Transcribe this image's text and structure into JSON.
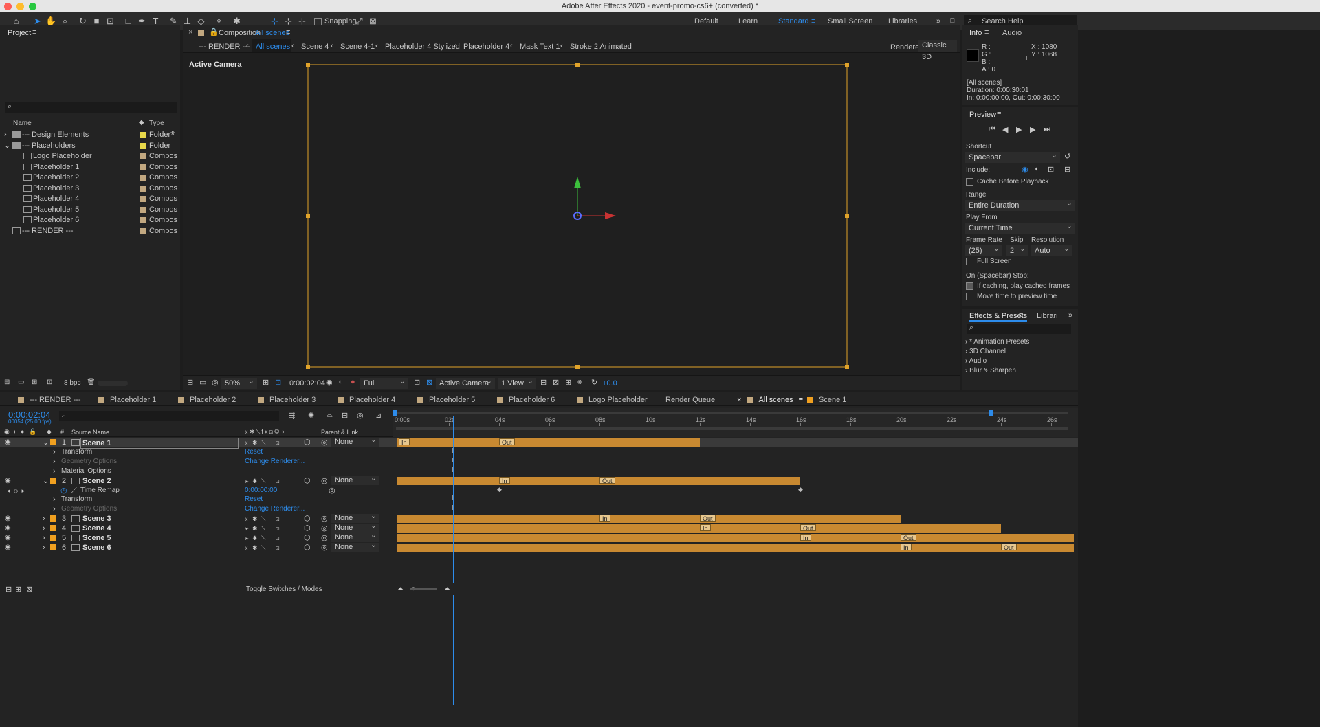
{
  "window": {
    "title": "Adobe After Effects 2020 - event-promo-cs6+ (converted) *"
  },
  "toolbar": {
    "snapping_label": "Snapping",
    "workspaces": [
      "Default",
      "Learn",
      "Standard",
      "Small Screen",
      "Libraries"
    ],
    "search_placeholder": "Search Help"
  },
  "project": {
    "title": "Project",
    "col_name": "Name",
    "col_type": "Type",
    "items": [
      {
        "name": "--- Design Elements",
        "type": "Folder",
        "kind": "folder",
        "color": "#e8d84a"
      },
      {
        "name": "--- Placeholders",
        "type": "Folder",
        "kind": "folder",
        "color": "#e8d84a"
      },
      {
        "name": "Logo Placeholder",
        "type": "Compos",
        "kind": "comp",
        "color": "#c2a880"
      },
      {
        "name": "Placeholder 1",
        "type": "Compos",
        "kind": "comp",
        "color": "#c2a880"
      },
      {
        "name": "Placeholder 2",
        "type": "Compos",
        "kind": "comp",
        "color": "#c2a880"
      },
      {
        "name": "Placeholder 3",
        "type": "Compos",
        "kind": "comp",
        "color": "#c2a880"
      },
      {
        "name": "Placeholder 4",
        "type": "Compos",
        "kind": "comp",
        "color": "#c2a880"
      },
      {
        "name": "Placeholder 5",
        "type": "Compos",
        "kind": "comp",
        "color": "#c2a880"
      },
      {
        "name": "Placeholder 6",
        "type": "Compos",
        "kind": "comp",
        "color": "#c2a880"
      },
      {
        "name": "--- RENDER ---",
        "type": "Compos",
        "kind": "comp",
        "color": "#c2a880"
      }
    ],
    "bpc": "8 bpc"
  },
  "composition": {
    "tab_prefix": "Composition",
    "tab_name": "All scenes",
    "breadcrumbs": [
      "--- RENDER ---",
      "All scenes",
      "Scene 4",
      "Scene 4-1",
      "Placeholder 4 Stylized",
      "Placeholder 4",
      "Mask Text 1",
      "Stroke 2 Animated"
    ],
    "renderer_label": "Renderer:",
    "renderer_value": "Classic 3D",
    "active_camera": "Active Camera",
    "footer": {
      "zoom": "50%",
      "timecode": "0:00:02:04",
      "resolution": "Full",
      "camera": "Active Camera",
      "views": "1 View",
      "exposure": "+0.0"
    }
  },
  "info": {
    "tabs": [
      "Info",
      "Audio"
    ],
    "r": "R :",
    "g": "G :",
    "b": "B :",
    "a": "A : 0",
    "x": "X : 1080",
    "y": "Y : 1068",
    "lines": [
      "[All scenes]",
      "Duration: 0:00:30:01",
      "In: 0:00:00:00, Out: 0:00:30:00"
    ]
  },
  "preview": {
    "title": "Preview",
    "shortcut_label": "Shortcut",
    "shortcut": "Spacebar",
    "include_label": "Include:",
    "cache_label": "Cache Before Playback",
    "range_label": "Range",
    "range": "Entire Duration",
    "playfrom_label": "Play From",
    "playfrom": "Current Time",
    "framerate_label": "Frame Rate",
    "skip_label": "Skip",
    "resolution_label": "Resolution",
    "framerate": "(25)",
    "skip": "2",
    "resolution": "Auto",
    "fullscreen_label": "Full Screen",
    "onstop_label": "On (Spacebar) Stop:",
    "ifcaching_label": "If caching, play cached frames",
    "movetime_label": "Move time to preview time"
  },
  "effects": {
    "tabs": [
      "Effects & Presets",
      "Librari"
    ],
    "items": [
      "* Animation Presets",
      "3D Channel",
      "Audio",
      "Blur & Sharpen"
    ]
  },
  "timeline": {
    "tabs": [
      {
        "label": "--- RENDER ---",
        "color": "#c2a880"
      },
      {
        "label": "Placeholder 1",
        "color": "#c2a880"
      },
      {
        "label": "Placeholder 2",
        "color": "#c2a880"
      },
      {
        "label": "Placeholder 3",
        "color": "#c2a880"
      },
      {
        "label": "Placeholder 4",
        "color": "#c2a880"
      },
      {
        "label": "Placeholder 5",
        "color": "#c2a880"
      },
      {
        "label": "Placeholder 6",
        "color": "#c2a880"
      },
      {
        "label": "Logo Placeholder",
        "color": "#c2a880"
      },
      {
        "label": "Render Queue",
        "color": ""
      },
      {
        "label": "All scenes",
        "color": "#c2a880"
      },
      {
        "label": "Scene 1",
        "color": "#f0a020"
      }
    ],
    "timecode": "0:00:02:04",
    "frames": "00054 (25.00 fps)",
    "col_source": "Source Name",
    "col_parent": "Parent & Link",
    "ruler": [
      "0:00s",
      "02s",
      "04s",
      "06s",
      "08s",
      "10s",
      "12s",
      "14s",
      "16s",
      "18s",
      "20s",
      "22s",
      "24s",
      "26s"
    ],
    "layers": [
      {
        "num": "1",
        "name": "Scene 1",
        "parent": "None",
        "start": 0,
        "end": 12,
        "in": 0,
        "out": 4
      },
      {
        "num": "2",
        "name": "Scene 2",
        "parent": "None",
        "start": 0,
        "end": 16,
        "in": 4,
        "out": 8
      },
      {
        "num": "3",
        "name": "Scene 3",
        "parent": "None",
        "start": 0,
        "end": 20,
        "in": 8,
        "out": 12
      },
      {
        "num": "4",
        "name": "Scene 4",
        "parent": "None",
        "start": 0,
        "end": 24,
        "in": 12,
        "out": 16
      },
      {
        "num": "5",
        "name": "Scene 5",
        "parent": "None",
        "start": 0,
        "end": 27,
        "in": 16,
        "out": 20
      },
      {
        "num": "6",
        "name": "Scene 6",
        "parent": "None",
        "start": 0,
        "end": 27,
        "in": 20,
        "out": 24
      }
    ],
    "props": {
      "transform": "Transform",
      "reset": "Reset",
      "geometry": "Geometry Options",
      "change_renderer": "Change Renderer...",
      "material": "Material Options",
      "time_remap": "Time Remap",
      "time_remap_value": "0:00:00:00"
    },
    "toggle_label": "Toggle Switches / Modes",
    "mark_in": "In",
    "mark_out": "Out",
    "current_time_seconds": 2.16
  }
}
